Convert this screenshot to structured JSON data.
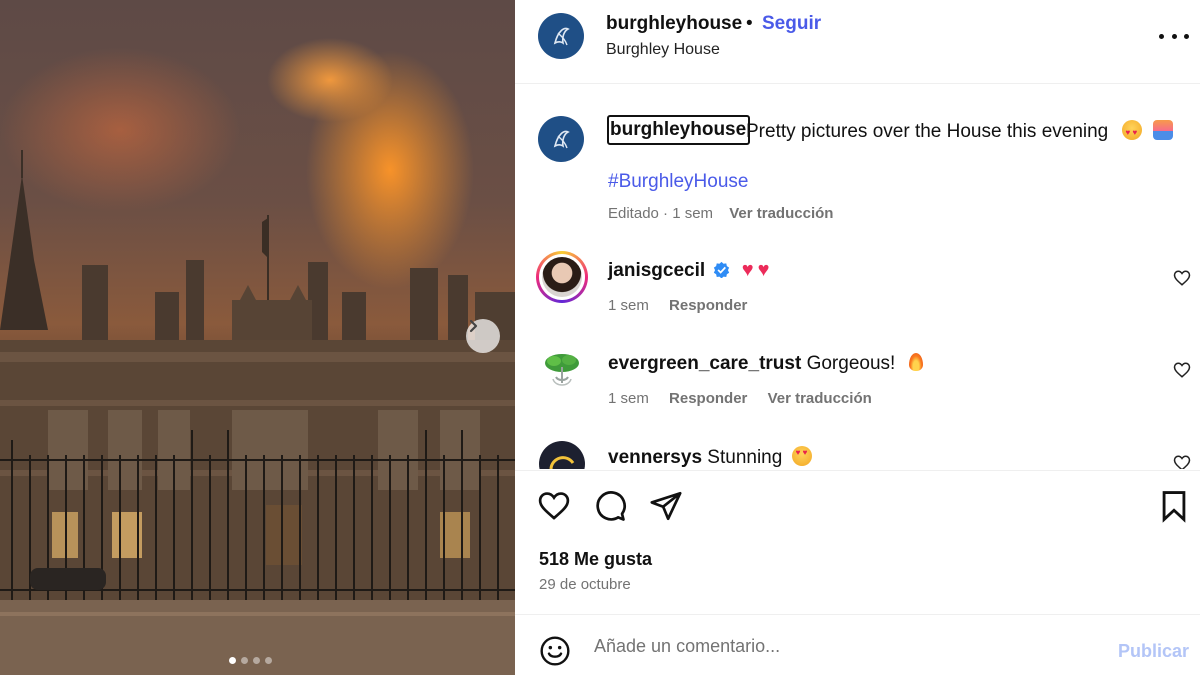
{
  "post": {
    "author": "burghleyhouse",
    "separator": "•",
    "follow_label": "Seguir",
    "location": "Burghley House",
    "caption_user": "burghleyhouse",
    "caption_text": "Pretty pictures over the House this evening",
    "hashtag": "#BurghleyHouse",
    "edited_label": "Editado · 1 sem",
    "translate_label": "Ver traducción"
  },
  "carousel": {
    "slide_count": 4,
    "active_slide": 1
  },
  "comments": [
    {
      "user": "janisgcecil",
      "text": "",
      "verified": true,
      "time": "1 sem",
      "reply_label": "Responder",
      "translate_label": ""
    },
    {
      "user": "evergreen_care_trust",
      "text": "Gorgeous!",
      "verified": false,
      "time": "1 sem",
      "reply_label": "Responder",
      "translate_label": "Ver traducción"
    },
    {
      "user": "vennersys",
      "text": "Stunning",
      "verified": false,
      "time": "",
      "reply_label": "",
      "translate_label": ""
    }
  ],
  "actions": {
    "likes_label": "518 Me gusta",
    "date_label": "29 de octubre"
  },
  "composer": {
    "placeholder": "Añade un comentario...",
    "publish_label": "Publicar"
  },
  "colors": {
    "link_blue": "#4a5ae8",
    "brand_avatar": "#1f4f86",
    "muted_text": "#737373",
    "publish_disabled": "#b3c5f7",
    "heart_red": "#ec2b5a",
    "verified_blue": "#2f8cf5"
  }
}
